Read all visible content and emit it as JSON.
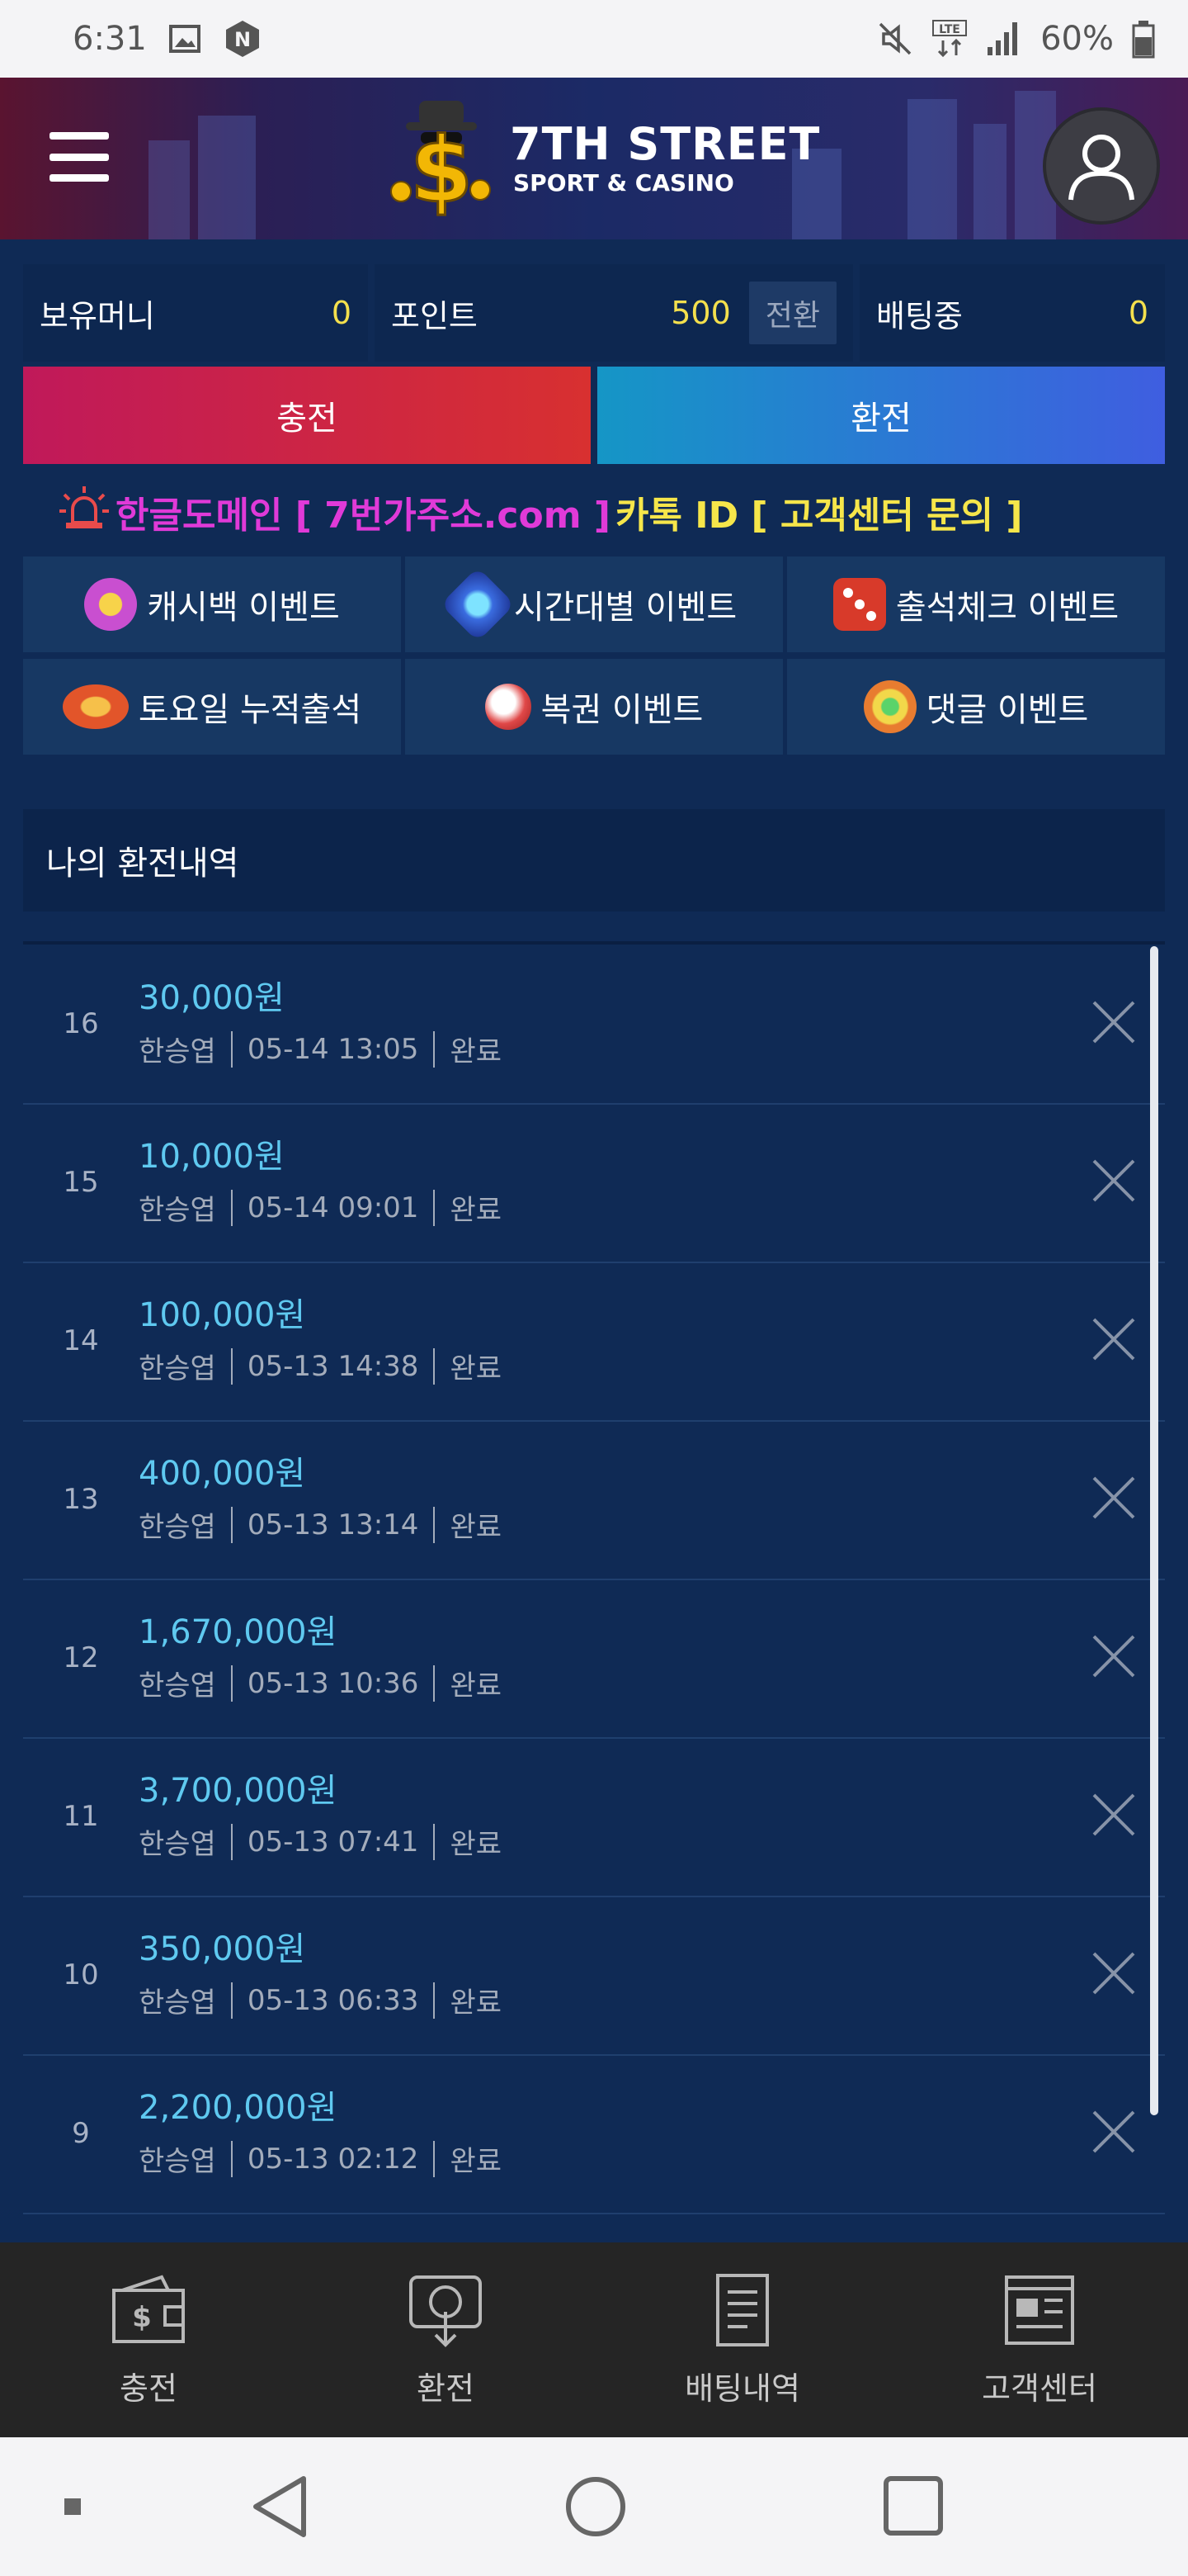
{
  "status_bar": {
    "time": "6:31",
    "battery": "60%",
    "network": "LTE"
  },
  "header": {
    "brand_title": "7TH STREET",
    "brand_subtitle": "SPORT & CASINO"
  },
  "balance": {
    "money_label": "보유머니",
    "money_value": "0",
    "point_label": "포인트",
    "point_value": "500",
    "convert_label": "전환",
    "betting_label": "배팅중",
    "betting_value": "0"
  },
  "actions": {
    "charge_label": "충전",
    "exchange_label": "환전"
  },
  "notice": {
    "domain_text": "한글도메인 [ 7번가주소.com ]",
    "kakao_text": "카톡 ID [ 고객센터 문의 ]"
  },
  "events": [
    {
      "label": "캐시백 이벤트",
      "icon": "cashback-coin-icon",
      "color": "#d04cc8"
    },
    {
      "label": "시간대별 이벤트",
      "icon": "time-gem-icon",
      "color": "#3a8ce0"
    },
    {
      "label": "출석체크 이벤트",
      "icon": "dice-icon",
      "color": "#d83a2a"
    },
    {
      "label": "토요일 누적출석",
      "icon": "chip-icon",
      "color": "#e2552a"
    },
    {
      "label": "복권 이벤트",
      "icon": "lottery-ball-icon",
      "color": "#e04848"
    },
    {
      "label": "댓글 이벤트",
      "icon": "comment-coin-icon",
      "color": "#e87c30"
    }
  ],
  "history": {
    "title": "나의 환전내역",
    "rows": [
      {
        "num": "16",
        "amount": "30,000원",
        "name": "한승엽",
        "datetime": "05-14 13:05",
        "status": "완료"
      },
      {
        "num": "15",
        "amount": "10,000원",
        "name": "한승엽",
        "datetime": "05-14 09:01",
        "status": "완료"
      },
      {
        "num": "14",
        "amount": "100,000원",
        "name": "한승엽",
        "datetime": "05-13 14:38",
        "status": "완료"
      },
      {
        "num": "13",
        "amount": "400,000원",
        "name": "한승엽",
        "datetime": "05-13 13:14",
        "status": "완료"
      },
      {
        "num": "12",
        "amount": "1,670,000원",
        "name": "한승엽",
        "datetime": "05-13 10:36",
        "status": "완료"
      },
      {
        "num": "11",
        "amount": "3,700,000원",
        "name": "한승엽",
        "datetime": "05-13 07:41",
        "status": "완료"
      },
      {
        "num": "10",
        "amount": "350,000원",
        "name": "한승엽",
        "datetime": "05-13 06:33",
        "status": "완료"
      },
      {
        "num": "9",
        "amount": "2,200,000원",
        "name": "한승엽",
        "datetime": "05-13 02:12",
        "status": "완료"
      }
    ]
  },
  "bottom_nav": [
    {
      "label": "충전",
      "icon": "wallet-icon"
    },
    {
      "label": "환전",
      "icon": "withdraw-icon"
    },
    {
      "label": "배팅내역",
      "icon": "document-icon"
    },
    {
      "label": "고객센터",
      "icon": "news-icon"
    }
  ],
  "colors": {
    "background": "#0f2a55",
    "accent_yellow": "#f4e04d",
    "amount_blue": "#5fc9f0",
    "charge": "#c0195a",
    "exchange": "#1596c6"
  }
}
